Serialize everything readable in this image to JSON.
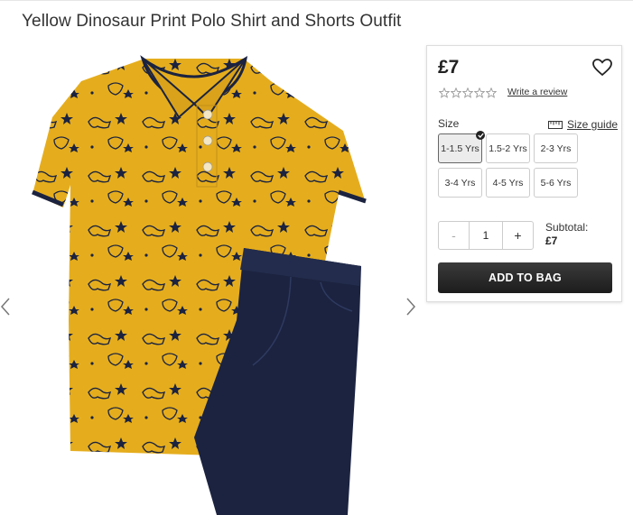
{
  "product": {
    "title": "Yellow Dinosaur Print Polo Shirt and Shorts Outfit",
    "price": "£7",
    "rating_stars": 0,
    "write_review_label": "Write a review",
    "image_alt": "Yellow dinosaur print polo shirt with navy shorts",
    "image_icon": "product-photo"
  },
  "gallery": {
    "prev_icon": "chevron-left-icon",
    "next_icon": "chevron-right-icon"
  },
  "size": {
    "label": "Size",
    "guide_label": "Size guide",
    "options": [
      "1-1.5 Yrs",
      "1.5-2 Yrs",
      "2-3 Yrs",
      "3-4 Yrs",
      "4-5 Yrs",
      "5-6 Yrs"
    ],
    "selected": "1-1.5 Yrs"
  },
  "quantity": {
    "minus_label": "-",
    "value": "1",
    "plus_label": "+"
  },
  "subtotal": {
    "label": "Subtotal:",
    "amount": "£7"
  },
  "cart": {
    "add_label": "ADD TO BAG"
  },
  "colors": {
    "shirt": "#e5ad1d",
    "navy": "#1b2340",
    "button_dark": "#222222"
  }
}
